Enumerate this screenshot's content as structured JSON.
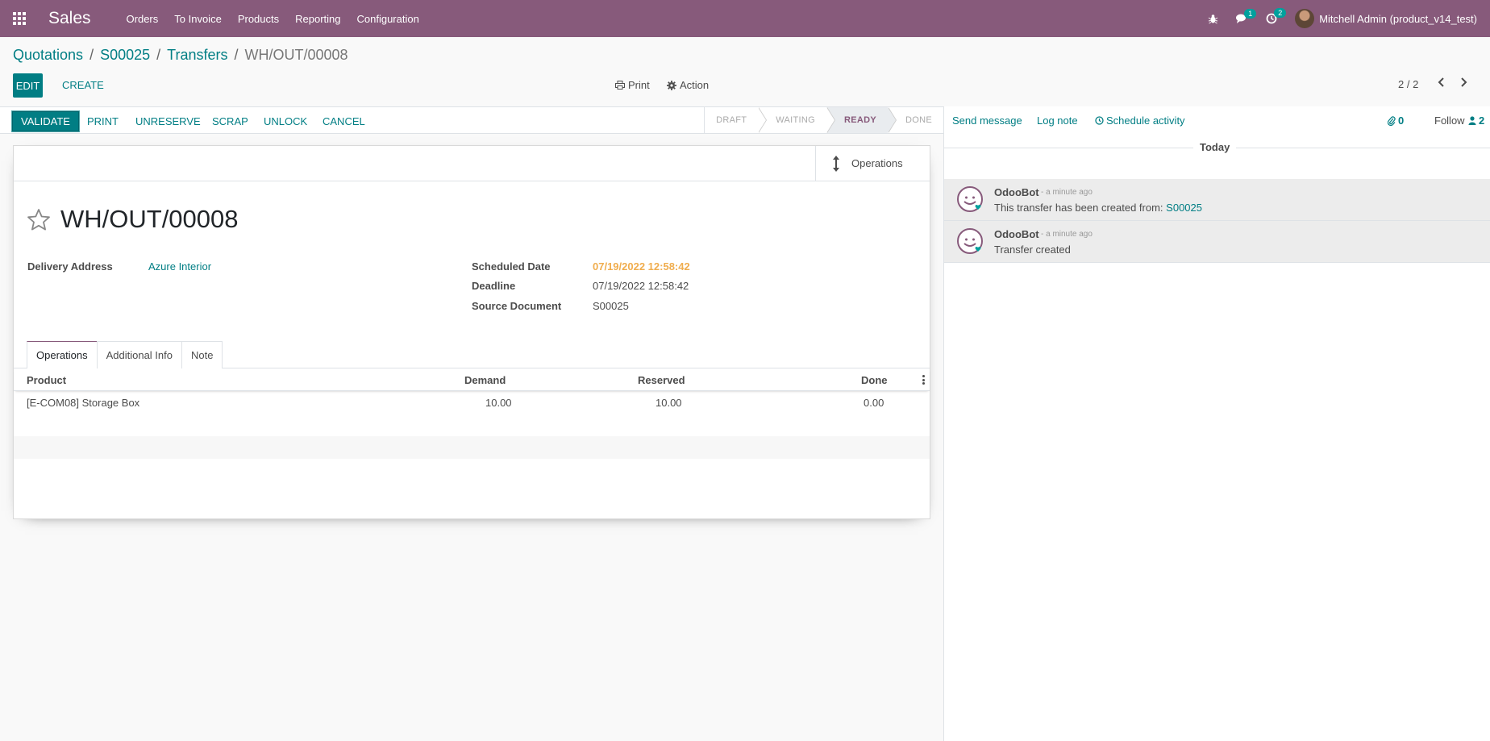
{
  "navbar": {
    "app_name": "Sales",
    "menu": [
      "Orders",
      "To Invoice",
      "Products",
      "Reporting",
      "Configuration"
    ],
    "messages_count": "1",
    "activities_count": "2",
    "user": "Mitchell Admin (product_v14_test)"
  },
  "breadcrumb": {
    "items": [
      "Quotations",
      "S00025",
      "Transfers"
    ],
    "current": "WH/OUT/00008"
  },
  "control": {
    "edit": "EDIT",
    "create": "CREATE",
    "print": "Print",
    "action": "Action",
    "pager": "2 / 2"
  },
  "statusbar": {
    "buttons": [
      "VALIDATE",
      "PRINT",
      "UNRESERVE",
      "SCRAP",
      "UNLOCK",
      "CANCEL"
    ],
    "stages": [
      "DRAFT",
      "WAITING",
      "READY",
      "DONE"
    ],
    "active_stage": "READY"
  },
  "form": {
    "smart_button": "Operations",
    "title": "WH/OUT/00008",
    "delivery_address_label": "Delivery Address",
    "delivery_address": "Azure Interior",
    "scheduled_date_label": "Scheduled Date",
    "scheduled_date": "07/19/2022 12:58:42",
    "deadline_label": "Deadline",
    "deadline": "07/19/2022 12:58:42",
    "source_document_label": "Source Document",
    "source_document": "S00025",
    "tabs": [
      "Operations",
      "Additional Info",
      "Note"
    ],
    "table": {
      "headers": [
        "Product",
        "Demand",
        "Reserved",
        "Done"
      ],
      "rows": [
        {
          "product": "[E-COM08] Storage Box",
          "demand": "10.00",
          "reserved": "10.00",
          "done": "0.00"
        }
      ]
    }
  },
  "chatter": {
    "send_message": "Send message",
    "log_note": "Log note",
    "schedule_activity": "Schedule activity",
    "attachments": "0",
    "follow": "Follow",
    "followers": "2",
    "separator": "Today",
    "messages": [
      {
        "author": "OdooBot",
        "date": "- a minute ago",
        "body": "This transfer has been created from:",
        "link": "S00025"
      },
      {
        "author": "OdooBot",
        "date": "- a minute ago",
        "body": "Transfer created"
      }
    ]
  },
  "colors": {
    "navbar": "#875a7b",
    "primary": "#017e84",
    "warning": "#f0ad4e"
  }
}
